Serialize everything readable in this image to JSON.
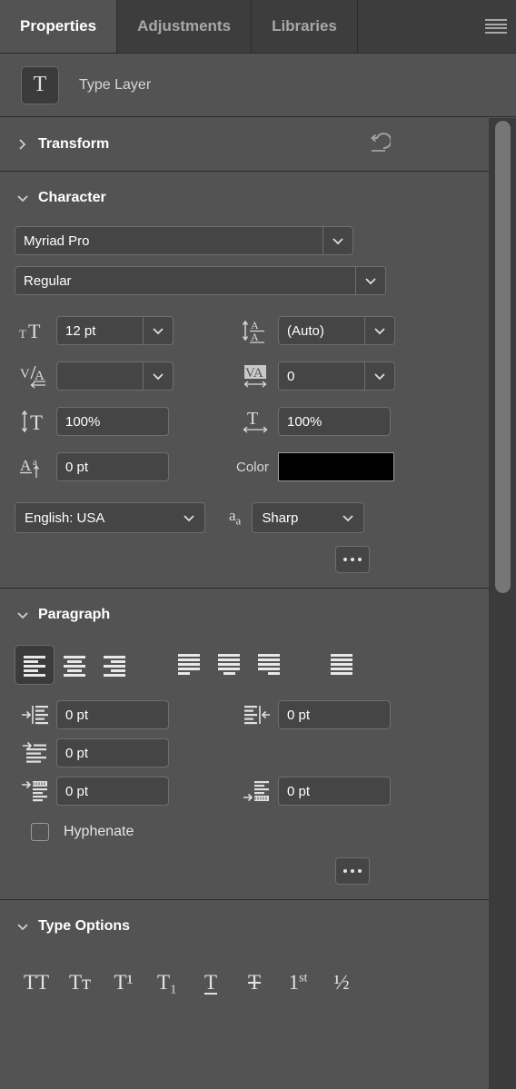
{
  "tabs": [
    {
      "label": "Properties",
      "active": true
    },
    {
      "label": "Adjustments",
      "active": false
    },
    {
      "label": "Libraries",
      "active": false
    }
  ],
  "panel_menu_icon": "hamburger-menu-icon",
  "layer": {
    "thumb_glyph": "T",
    "thumb_icon": "type-layer-icon",
    "name": "Type Layer"
  },
  "sections": {
    "transform": {
      "title": "Transform",
      "collapsed": true,
      "twisty": "›",
      "reset_icon": "reset-arrow-icon"
    },
    "character": {
      "title": "Character",
      "collapsed": false,
      "twisty": "⌄",
      "font_family": "Myriad Pro",
      "font_style": "Regular",
      "font_size": "12 pt",
      "leading": "(Auto)",
      "kerning": "",
      "tracking": "0",
      "vertical_scale": "100%",
      "horizontal_scale": "100%",
      "baseline_shift": "0 pt",
      "color_label": "Color",
      "color_value": "#000000",
      "language": "English: USA",
      "anti_alias": "Sharp",
      "more_label": "•••"
    },
    "paragraph": {
      "title": "Paragraph",
      "collapsed": false,
      "twisty": "⌄",
      "alignments": [
        {
          "name": "align-left",
          "selected": true
        },
        {
          "name": "align-center",
          "selected": false
        },
        {
          "name": "align-right",
          "selected": false
        },
        {
          "name": "justify-last-left",
          "selected": false
        },
        {
          "name": "justify-last-center",
          "selected": false
        },
        {
          "name": "justify-last-right",
          "selected": false
        },
        {
          "name": "justify-all",
          "selected": false
        }
      ],
      "indent_left": "0 pt",
      "indent_right": "0 pt",
      "indent_first_line": "0 pt",
      "space_before": "0 pt",
      "space_after": "0 pt",
      "hyphenate_label": "Hyphenate",
      "hyphenate_checked": false,
      "more_label": "•••"
    },
    "type_options": {
      "title": "Type Options",
      "collapsed": false,
      "twisty": "⌄",
      "options": [
        {
          "name": "all-caps",
          "glyph": "TT"
        },
        {
          "name": "small-caps",
          "glyph": "Tᴛ"
        },
        {
          "name": "superscript",
          "glyph": "T¹"
        },
        {
          "name": "subscript",
          "glyph": "T₁"
        },
        {
          "name": "underline",
          "glyph": "T"
        },
        {
          "name": "strikethrough",
          "glyph": "T"
        },
        {
          "name": "ordinals",
          "glyph": "1st"
        },
        {
          "name": "fractions",
          "glyph": "½"
        }
      ]
    }
  },
  "colors": {
    "panel_bg": "#535353",
    "tabbar_bg": "#3d3d3d",
    "field_bg": "#454545",
    "field_border": "#6e6e6e",
    "text": "#ffffff",
    "divider": "#2c2c2c",
    "scrollbar_thumb": "#767676",
    "scrollbar_track": "#3b3b3b"
  }
}
